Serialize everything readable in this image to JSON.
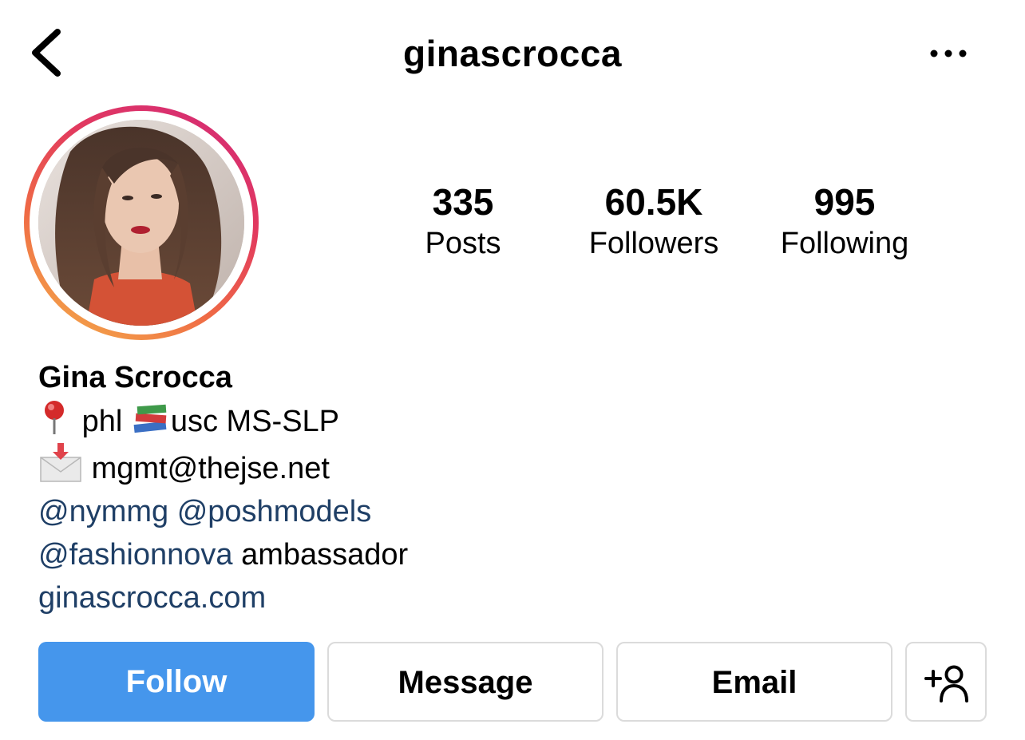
{
  "header": {
    "username": "ginascrocca",
    "back_icon": "chevron-left-icon",
    "more_icon": "more-horizontal-icon"
  },
  "profile": {
    "avatar_icon": "profile-photo",
    "story_ring_colors": [
      "#f5b54b",
      "#ef6a45",
      "#e23a5e",
      "#d2287a"
    ]
  },
  "stats": {
    "posts": {
      "value": "335",
      "label": "Posts"
    },
    "followers": {
      "value": "60.5K",
      "label": "Followers"
    },
    "following": {
      "value": "995",
      "label": "Following"
    }
  },
  "bio": {
    "name": "Gina Scrocca",
    "line1_text_a": "phl",
    "line1_text_b": "usc MS-SLP",
    "line2_text": "mgmt@thejse.net",
    "line3_mention_a": "@nymmg",
    "line3_mention_b": "@poshmodels",
    "line4_mention": "@fashionnova",
    "line4_text": "ambassador",
    "website": "ginascrocca.com",
    "link_color": "#1f3f66"
  },
  "actions": {
    "follow_label": "Follow",
    "message_label": "Message",
    "email_label": "Email",
    "add_user_icon": "add-user-icon",
    "follow_color": "#4596ec"
  }
}
